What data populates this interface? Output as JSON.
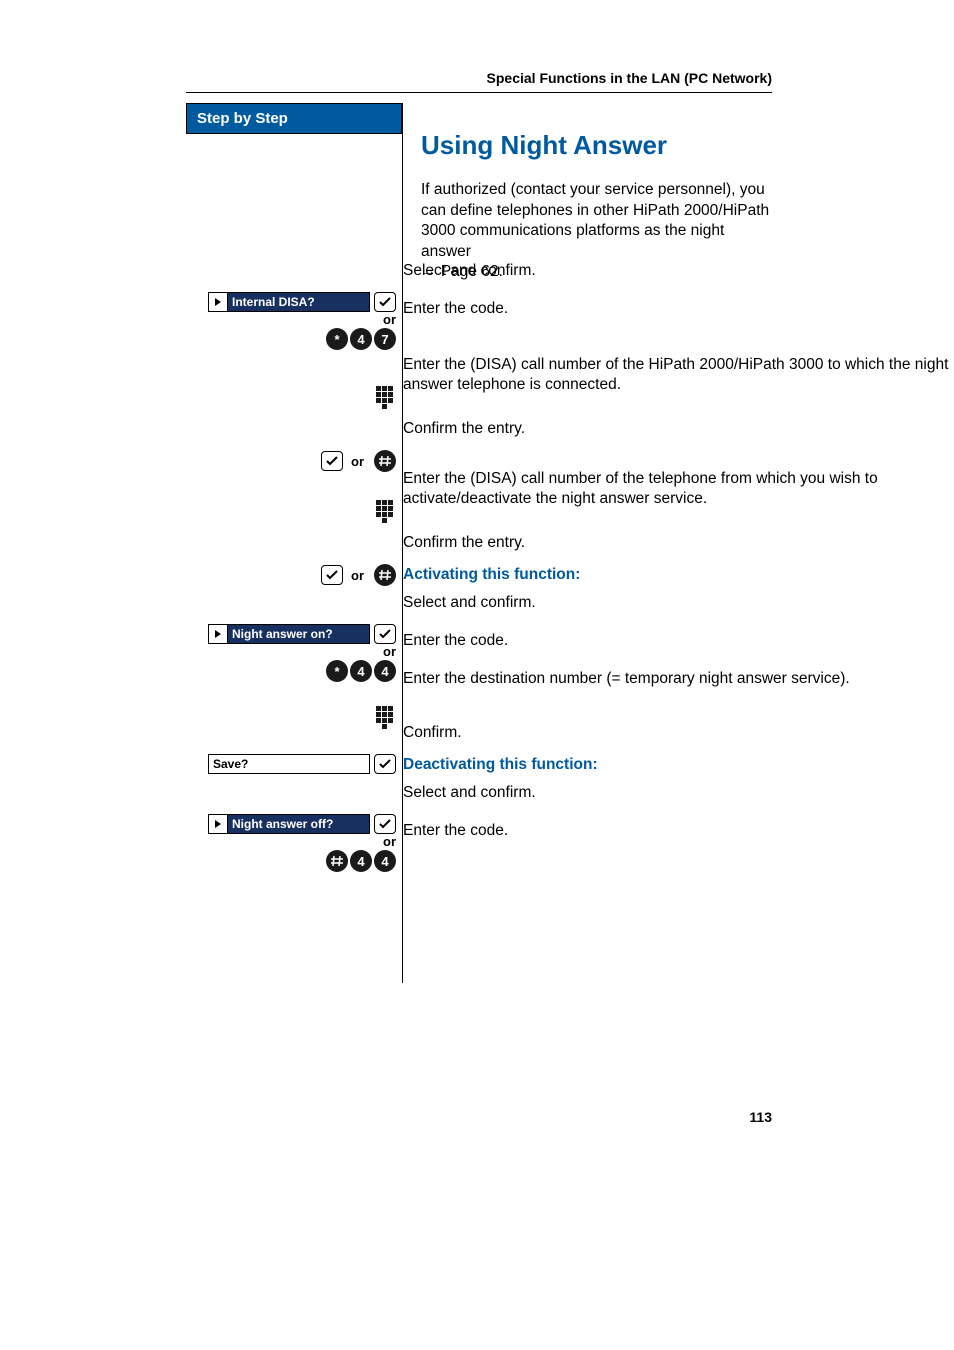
{
  "header": {
    "running_title": "Special Functions in the LAN (PC Network)"
  },
  "sidebar": {
    "title": "Step by Step",
    "rows": {
      "internal_disa": {
        "label": "Internal DISA?",
        "or": "or",
        "code_keys": [
          "*",
          "4",
          "7"
        ]
      },
      "confirm_or_1": {
        "or_text": "or"
      },
      "confirm_or_2": {
        "or_text": "or"
      },
      "night_on": {
        "label": "Night answer on?",
        "or": "or",
        "code_keys": [
          "*",
          "4",
          "4"
        ]
      },
      "save": {
        "label": "Save?"
      },
      "night_off": {
        "label": "Night answer off?",
        "or": "or",
        "code_keys": [
          "#",
          "4",
          "4"
        ]
      }
    }
  },
  "body": {
    "title": "Using Night Answer",
    "intro_1": "If authorized (contact your service personnel), you can define telephones in other HiPath 2000/HiPath 3000 communications platforms as the night answer ",
    "intro_link": "Page 62",
    "select_confirm_1": "Select and confirm.",
    "enter_code_1": "Enter the code.",
    "disa_num_1": "Enter the (DISA) call number of the HiPath 2000/HiPath 3000 to which the night answer telephone is connected.",
    "confirm_entry_1": "Confirm the entry.",
    "disa_num_2": "Enter the (DISA) call number of the telephone from which you wish to activate/deactivate the night answer service.",
    "confirm_entry_2": "Confirm the entry.",
    "activating_heading": "Activating this function:",
    "select_confirm_2": "Select and confirm.",
    "enter_code_2": "Enter the code.",
    "dest_num": "Enter the destination number (= temporary night answer service).",
    "confirm": "Confirm.",
    "deactivating_heading": "Deactivating this function:",
    "select_confirm_3": "Select and confirm.",
    "enter_code_3": "Enter the code."
  },
  "page_number": "113"
}
